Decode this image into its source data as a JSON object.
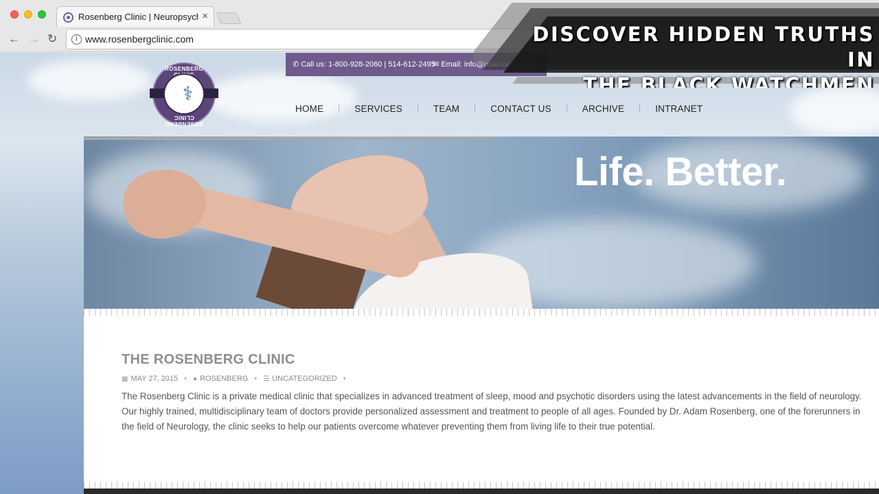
{
  "browser": {
    "tab_title": "Rosenberg Clinic | Neuropsych",
    "tab_close": "×",
    "url": "www.rosenbergclinic.com",
    "info_glyph": "i",
    "back_icon": "←",
    "forward_icon": "→",
    "reload_icon": "↻"
  },
  "topbar": {
    "phone": "Call us: 1-800-928-2060 | 514-612-2495",
    "email": "Email: info@rosenbergclinic",
    "phone_icon": "✆",
    "email_icon": "✉",
    "bg_color": "#6f5a8c"
  },
  "logo": {
    "text_top": "ROSENBERG CLINIC",
    "text_bottom": "ROSENBERG CLINIC"
  },
  "nav": {
    "items": [
      "HOME",
      "SERVICES",
      "TEAM",
      "CONTACT US",
      "ARCHIVE",
      "INTRANET"
    ]
  },
  "hero": {
    "title": "Life. Better."
  },
  "post": {
    "title": "THE ROSENBERG CLINIC",
    "date": "MAY 27, 2015",
    "author": "ROSENBERG",
    "category": "UNCATEGORIZED",
    "body": "The Rosenberg Clinic is a private medical clinic that specializes in advanced treatment of sleep, mood and psychotic disorders using the latest advancements in the field of neurology. Our highly trained, multidisciplinary team of doctors provide personalized assessment and treatment to people of all ages. Founded by Dr. Adam Rosenberg, one of the forerunners in the field of Neurology, the clinic seeks to help our patients overcome whatever preventing them from living life to their true potential."
  },
  "overlay": {
    "line1": "DISCOVER HIDDEN TRUTHS IN",
    "line2": "THE BLACK WATCHMEN HISTORY"
  }
}
